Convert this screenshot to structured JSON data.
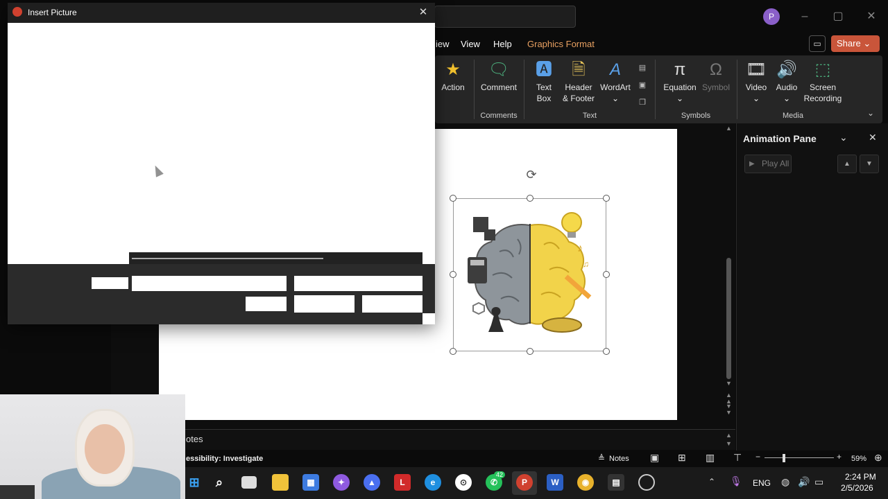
{
  "window": {
    "avatar_letter": "P"
  },
  "menu": {
    "items": [
      "iew",
      "View",
      "Help"
    ],
    "contextual_tab": "Graphics Format",
    "share_label": "Share",
    "accent_color": "#e8a061"
  },
  "ribbon": {
    "buttons": {
      "action": "Action",
      "comment": "Comment",
      "text_box_1": "Text",
      "text_box_2": "Box",
      "header_footer_1": "Header",
      "header_footer_2": "& Footer",
      "wordart": "WordArt",
      "equation": "Equation",
      "symbol": "Symbol",
      "video": "Video",
      "audio": "Audio",
      "screen_recording_1": "Screen",
      "screen_recording_2": "Recording"
    },
    "groups": {
      "comments": "Comments",
      "text": "Text",
      "symbols": "Symbols",
      "media": "Media"
    }
  },
  "animation_pane": {
    "title": "Animation Pane",
    "play_all": "Play All"
  },
  "dialog": {
    "title": "Insert Picture"
  },
  "notes": {
    "label": "otes"
  },
  "status": {
    "accessibility": "essibility: Investigate",
    "notes_button": "Notes",
    "zoom": "59%"
  },
  "taskbar": {
    "whatsapp_badge": "42",
    "language": "ENG",
    "time": "2:24 PM",
    "date": "2/5/2026"
  }
}
